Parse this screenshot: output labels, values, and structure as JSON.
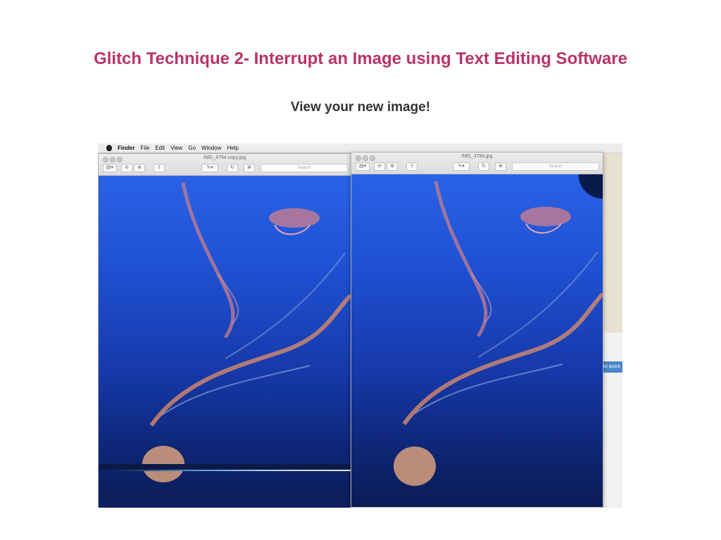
{
  "slide": {
    "title": "Glitch Technique 2- Interrupt an Image using Text Editing Software",
    "subtitle": "View your new image!"
  },
  "menubar": {
    "items": [
      "Finder",
      "File",
      "Edit",
      "View",
      "Go",
      "Window",
      "Help"
    ]
  },
  "windows": {
    "left": {
      "title": "IMG_4794 copy.jpg",
      "search_placeholder": "Search"
    },
    "right": {
      "title": "IMG_4794.jpg",
      "search_placeholder": "Search"
    }
  },
  "desktop": {
    "side_label": "to quick"
  },
  "colors": {
    "title": "#b8336a",
    "subtitle": "#333333",
    "water": "#1e4fd0"
  }
}
